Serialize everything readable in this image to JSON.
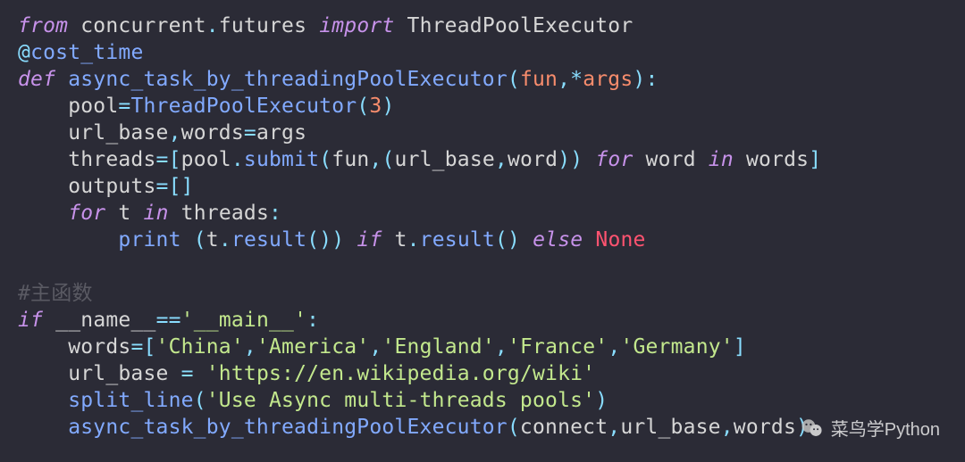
{
  "code": {
    "lines": [
      [
        {
          "cls": "kw",
          "t": "from"
        },
        {
          "cls": "id",
          "t": " concurrent"
        },
        {
          "cls": "op",
          "t": "."
        },
        {
          "cls": "id",
          "t": "futures "
        },
        {
          "cls": "kw",
          "t": "import"
        },
        {
          "cls": "id",
          "t": " ThreadPoolExecutor"
        }
      ],
      [
        {
          "cls": "op",
          "t": "@"
        },
        {
          "cls": "dec",
          "t": "cost_time"
        }
      ],
      [
        {
          "cls": "kw",
          "t": "def"
        },
        {
          "cls": "id",
          "t": " "
        },
        {
          "cls": "fn",
          "t": "async_task_by_threadingPoolExecutor"
        },
        {
          "cls": "op",
          "t": "("
        },
        {
          "cls": "param",
          "t": "fun"
        },
        {
          "cls": "op",
          "t": ",*"
        },
        {
          "cls": "param",
          "t": "args"
        },
        {
          "cls": "op",
          "t": "):"
        }
      ],
      [
        {
          "cls": "id",
          "t": "    pool"
        },
        {
          "cls": "op",
          "t": "="
        },
        {
          "cls": "fn",
          "t": "ThreadPoolExecutor"
        },
        {
          "cls": "op",
          "t": "("
        },
        {
          "cls": "num",
          "t": "3"
        },
        {
          "cls": "op",
          "t": ")"
        }
      ],
      [
        {
          "cls": "id",
          "t": "    url_base"
        },
        {
          "cls": "op",
          "t": ","
        },
        {
          "cls": "id",
          "t": "words"
        },
        {
          "cls": "op",
          "t": "="
        },
        {
          "cls": "id",
          "t": "args"
        }
      ],
      [
        {
          "cls": "id",
          "t": "    threads"
        },
        {
          "cls": "op",
          "t": "=["
        },
        {
          "cls": "id",
          "t": "pool"
        },
        {
          "cls": "op",
          "t": "."
        },
        {
          "cls": "fn",
          "t": "submit"
        },
        {
          "cls": "op",
          "t": "("
        },
        {
          "cls": "id",
          "t": "fun"
        },
        {
          "cls": "op",
          "t": ",("
        },
        {
          "cls": "id",
          "t": "url_base"
        },
        {
          "cls": "op",
          "t": ","
        },
        {
          "cls": "id",
          "t": "word"
        },
        {
          "cls": "op",
          "t": ")) "
        },
        {
          "cls": "kw",
          "t": "for"
        },
        {
          "cls": "id",
          "t": " word "
        },
        {
          "cls": "kw",
          "t": "in"
        },
        {
          "cls": "id",
          "t": " words"
        },
        {
          "cls": "op",
          "t": "]"
        }
      ],
      [
        {
          "cls": "id",
          "t": "    outputs"
        },
        {
          "cls": "op",
          "t": "=[]"
        }
      ],
      [
        {
          "cls": "id",
          "t": "    "
        },
        {
          "cls": "kw",
          "t": "for"
        },
        {
          "cls": "id",
          "t": " t "
        },
        {
          "cls": "kw",
          "t": "in"
        },
        {
          "cls": "id",
          "t": " threads"
        },
        {
          "cls": "op",
          "t": ":"
        }
      ],
      [
        {
          "cls": "id",
          "t": "        "
        },
        {
          "cls": "fn",
          "t": "print"
        },
        {
          "cls": "id",
          "t": " "
        },
        {
          "cls": "op",
          "t": "("
        },
        {
          "cls": "id",
          "t": "t"
        },
        {
          "cls": "op",
          "t": "."
        },
        {
          "cls": "fn",
          "t": "result"
        },
        {
          "cls": "op",
          "t": "()) "
        },
        {
          "cls": "kw",
          "t": "if"
        },
        {
          "cls": "id",
          "t": " t"
        },
        {
          "cls": "op",
          "t": "."
        },
        {
          "cls": "fn",
          "t": "result"
        },
        {
          "cls": "op",
          "t": "() "
        },
        {
          "cls": "kw",
          "t": "else"
        },
        {
          "cls": "id",
          "t": " "
        },
        {
          "cls": "none",
          "t": "None"
        }
      ],
      [
        {
          "cls": "id",
          "t": ""
        }
      ],
      [
        {
          "cls": "cmt",
          "t": "#主函数"
        }
      ],
      [
        {
          "cls": "kw",
          "t": "if"
        },
        {
          "cls": "id",
          "t": " "
        },
        {
          "cls": "mag",
          "t": "__name__"
        },
        {
          "cls": "op",
          "t": "=="
        },
        {
          "cls": "str",
          "t": "'__main__'"
        },
        {
          "cls": "op",
          "t": ":"
        }
      ],
      [
        {
          "cls": "id",
          "t": "    words"
        },
        {
          "cls": "op",
          "t": "=["
        },
        {
          "cls": "str",
          "t": "'China'"
        },
        {
          "cls": "op",
          "t": ","
        },
        {
          "cls": "str",
          "t": "'America'"
        },
        {
          "cls": "op",
          "t": ","
        },
        {
          "cls": "str",
          "t": "'England'"
        },
        {
          "cls": "op",
          "t": ","
        },
        {
          "cls": "str",
          "t": "'France'"
        },
        {
          "cls": "op",
          "t": ","
        },
        {
          "cls": "str",
          "t": "'Germany'"
        },
        {
          "cls": "op",
          "t": "]"
        }
      ],
      [
        {
          "cls": "id",
          "t": "    url_base "
        },
        {
          "cls": "op",
          "t": "="
        },
        {
          "cls": "id",
          "t": " "
        },
        {
          "cls": "str",
          "t": "'https://en.wikipedia.org/wiki'"
        }
      ],
      [
        {
          "cls": "id",
          "t": "    "
        },
        {
          "cls": "fn",
          "t": "split_line"
        },
        {
          "cls": "op",
          "t": "("
        },
        {
          "cls": "str",
          "t": "'Use Async multi-threads pools'"
        },
        {
          "cls": "op",
          "t": ")"
        }
      ],
      [
        {
          "cls": "id",
          "t": "    "
        },
        {
          "cls": "fn",
          "t": "async_task_by_threadingPoolExecutor"
        },
        {
          "cls": "op",
          "t": "("
        },
        {
          "cls": "id",
          "t": "connect"
        },
        {
          "cls": "op",
          "t": ","
        },
        {
          "cls": "id",
          "t": "url_base"
        },
        {
          "cls": "op",
          "t": ","
        },
        {
          "cls": "id",
          "t": "words"
        },
        {
          "cls": "op",
          "t": ")"
        }
      ]
    ]
  },
  "watermark": {
    "text": "菜鸟学Python",
    "icon": "wechat-icon"
  }
}
